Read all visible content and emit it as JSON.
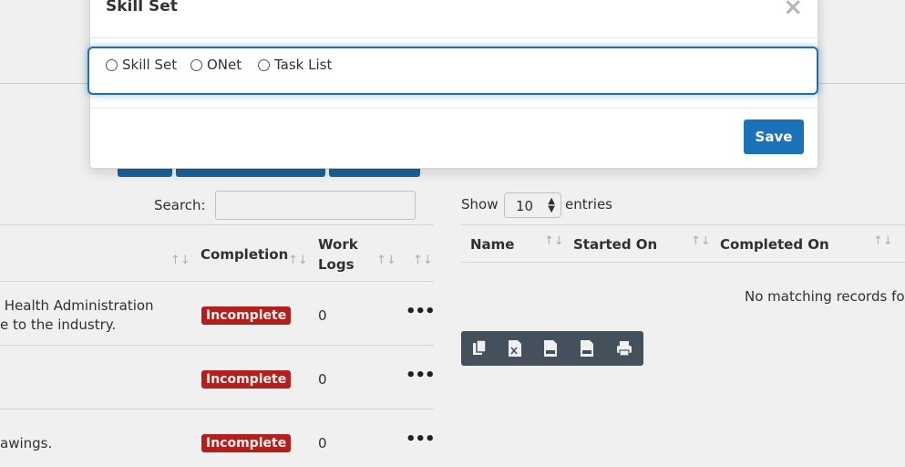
{
  "modal": {
    "title": "Skill Set",
    "close_glyph": "×",
    "options": [
      "Skill Set",
      "ONet",
      "Task List"
    ],
    "save_label": "Save"
  },
  "left": {
    "search_label": "Search:",
    "columns": {
      "completion": "Completion",
      "work_logs_line1": "Work",
      "work_logs_line2": "Logs"
    },
    "rows": [
      {
        "desc": " Health Administration\ne to the industry.",
        "status": "Incomplete",
        "logs": "0"
      },
      {
        "desc": "",
        "status": "Incomplete",
        "logs": "0"
      },
      {
        "desc": "awings.",
        "status": "Incomplete",
        "logs": "0"
      }
    ],
    "row_actions": "•••"
  },
  "right": {
    "show_label": "Show",
    "entries_value": "10",
    "entries_label": "entries",
    "columns": [
      "Name",
      "Started On",
      "Completed On"
    ],
    "no_records": "No matching records fo",
    "export_icons": [
      "copy-icon",
      "excel-icon",
      "csv-icon",
      "pdf-icon",
      "print-icon"
    ]
  },
  "sort_glyph": "↑↓",
  "colors": {
    "primary": "#1a73b8",
    "danger": "#c0211d",
    "toolbar": "#4a5563"
  }
}
